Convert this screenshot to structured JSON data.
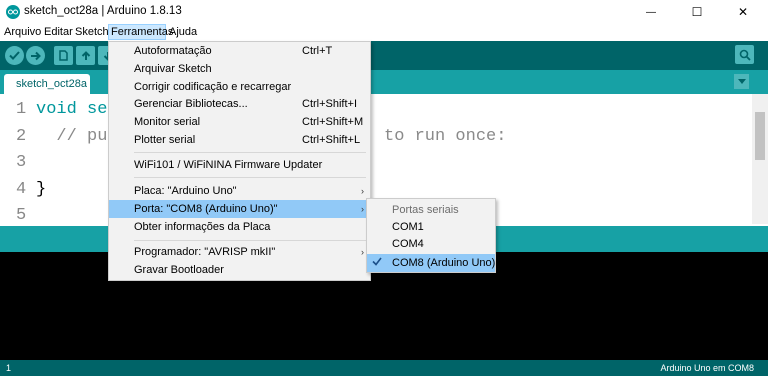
{
  "window": {
    "title": "sketch_oct28a | Arduino 1.8.13",
    "minimize_glyph": "—",
    "maximize_glyph": "☐",
    "close_glyph": "✕"
  },
  "menubar": {
    "items": [
      {
        "label": "Arquivo"
      },
      {
        "label": "Editar"
      },
      {
        "label": "Sketch"
      },
      {
        "label": "Ferramentas"
      },
      {
        "label": "Ajuda"
      }
    ]
  },
  "toolbar": {
    "icons": [
      "verify-icon",
      "upload-icon",
      "new-icon",
      "open-icon",
      "save-icon",
      "serial-monitor-icon"
    ]
  },
  "tabs": [
    {
      "label": "sketch_oct28a"
    }
  ],
  "editor": {
    "line_numbers": [
      "1",
      "2",
      "3",
      "4",
      "5"
    ],
    "lines": [
      "void se",
      "  // pu",
      "",
      "}",
      ""
    ],
    "fragment_right": "to run once:"
  },
  "tools_menu": {
    "items": [
      {
        "label": "Autoformatação",
        "shortcut": "Ctrl+T"
      },
      {
        "label": "Arquivar Sketch",
        "shortcut": ""
      },
      {
        "label": "Corrigir codificação e recarregar",
        "shortcut": ""
      },
      {
        "label": "Gerenciar Bibliotecas...",
        "shortcut": "Ctrl+Shift+I"
      },
      {
        "label": "Monitor serial",
        "shortcut": "Ctrl+Shift+M"
      },
      {
        "label": "Plotter serial",
        "shortcut": "Ctrl+Shift+L"
      },
      {
        "label": "WiFi101 / WiFiNINA Firmware Updater",
        "shortcut": ""
      },
      {
        "label": "Placa: \"Arduino Uno\"",
        "shortcut": ""
      },
      {
        "label": "Porta: \"COM8 (Arduino Uno)\"",
        "shortcut": ""
      },
      {
        "label": "Obter informações da Placa",
        "shortcut": ""
      },
      {
        "label": "Programador: \"AVRISP mkII\"",
        "shortcut": ""
      },
      {
        "label": "Gravar Bootloader",
        "shortcut": ""
      }
    ]
  },
  "port_submenu": {
    "header": "Portas seriais",
    "items": [
      {
        "label": "COM1",
        "selected": false
      },
      {
        "label": "COM4",
        "selected": false
      },
      {
        "label": "COM8 (Arduino Uno)",
        "selected": true
      }
    ]
  },
  "status": {
    "line": "1",
    "board": "Arduino Uno em COM8"
  },
  "colors": {
    "toolbar": "#006468",
    "tabbar": "#17a1a5",
    "highlight": "#91c9f7",
    "console": "#000000"
  }
}
